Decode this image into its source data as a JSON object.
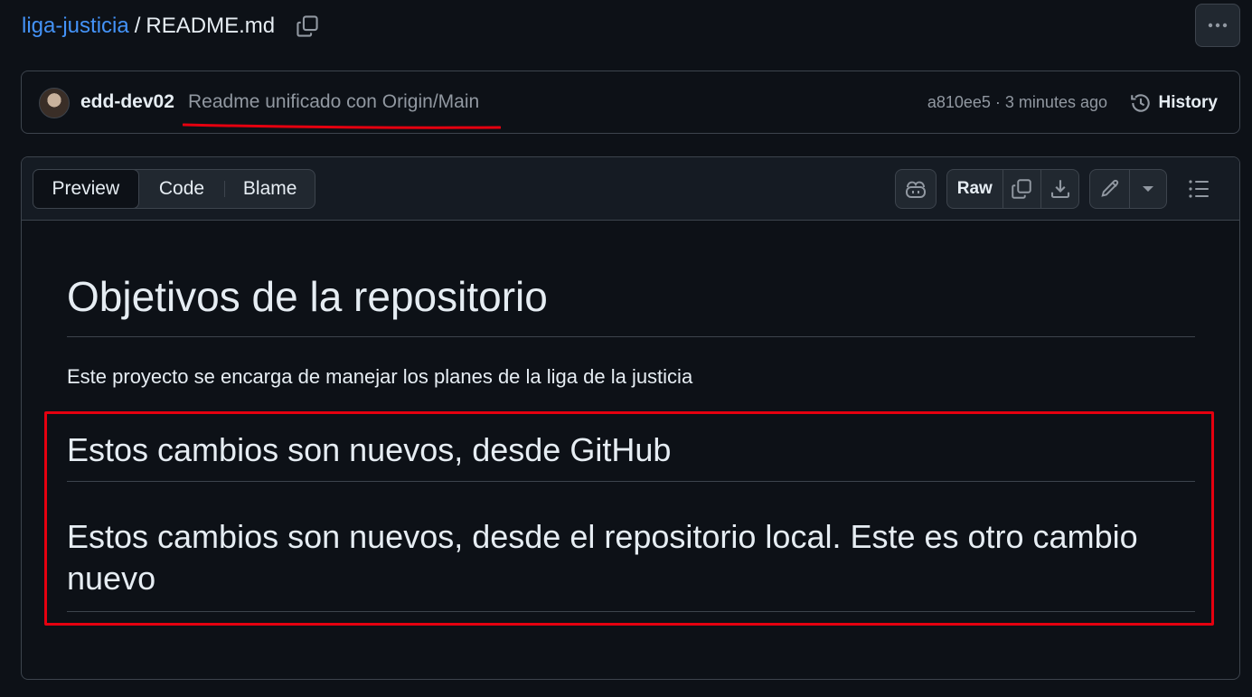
{
  "breadcrumb": {
    "repo": "liga-justicia",
    "separator": "/",
    "file": "README.md"
  },
  "commit": {
    "author": "edd-dev02",
    "message": "Readme unificado con Origin/Main",
    "meta": "a810ee5 · 3 minutes ago",
    "history_label": "History"
  },
  "file_header": {
    "tabs": [
      {
        "label": "Preview",
        "active": true
      },
      {
        "label": "Code",
        "active": false
      },
      {
        "label": "Blame",
        "active": false
      }
    ],
    "raw_label": "Raw"
  },
  "markdown": {
    "h1": "Objetivos de la repositorio",
    "paragraph": "Este proyecto se encarga de manejar los planes de la liga de la justicia",
    "h2_1": "Estos cambios son nuevos, desde GitHub",
    "h2_2": "Estos cambios son nuevos, desde el repositorio local. Este es otro cambio nuevo"
  },
  "colors": {
    "background": "#0d1117",
    "link": "#4493f8",
    "annotation_red": "#e5000f",
    "border": "#3d444d"
  },
  "icons": [
    "copy-icon",
    "kebab-icon",
    "history-icon",
    "copilot-icon",
    "copy-raw-icon",
    "download-icon",
    "pencil-icon",
    "triangle-down-icon",
    "list-icon"
  ]
}
